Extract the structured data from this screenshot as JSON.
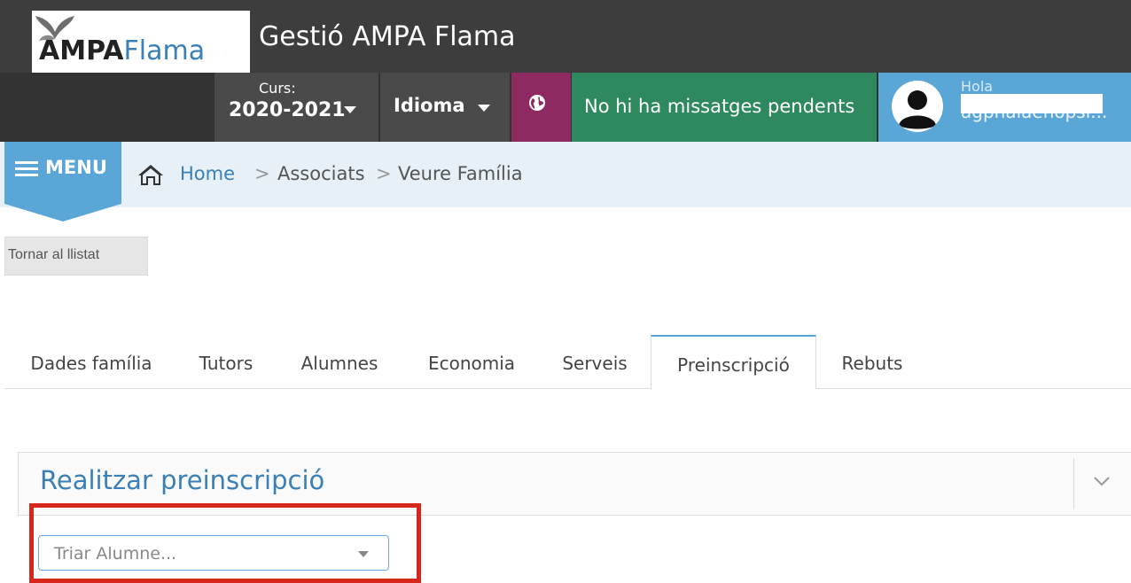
{
  "header": {
    "logo_bold": "AMPA",
    "logo_light": "Flama",
    "app_title": "Gestió AMPA Flama"
  },
  "nav": {
    "curs_label": "Curs:",
    "curs_value": "2020-2021",
    "idioma_label": "Idioma",
    "messages": "No hi ha missatges pendents",
    "user_greeting": "Hola",
    "user_name": "agpnalaenopsi..."
  },
  "breadcrumb": {
    "menu_label": "MENU",
    "home": "Home",
    "sep": ">",
    "level1": "Associats",
    "level2": "Veure Família"
  },
  "back_button": "Tornar al llistat",
  "tabs": [
    {
      "label": "Dades família",
      "active": false
    },
    {
      "label": "Tutors",
      "active": false
    },
    {
      "label": "Alumnes",
      "active": false
    },
    {
      "label": "Economia",
      "active": false
    },
    {
      "label": "Serveis",
      "active": false
    },
    {
      "label": "Preinscripció",
      "active": true
    },
    {
      "label": "Rebuts",
      "active": false
    }
  ],
  "panel": {
    "title": "Realitzar preinscripció",
    "select_placeholder": "Triar Alumne..."
  },
  "colors": {
    "accent_blue": "#5aa6d7",
    "message_green": "#2e8a5e",
    "globe_purple": "#8e2a61",
    "highlight_red": "#d7261b"
  }
}
